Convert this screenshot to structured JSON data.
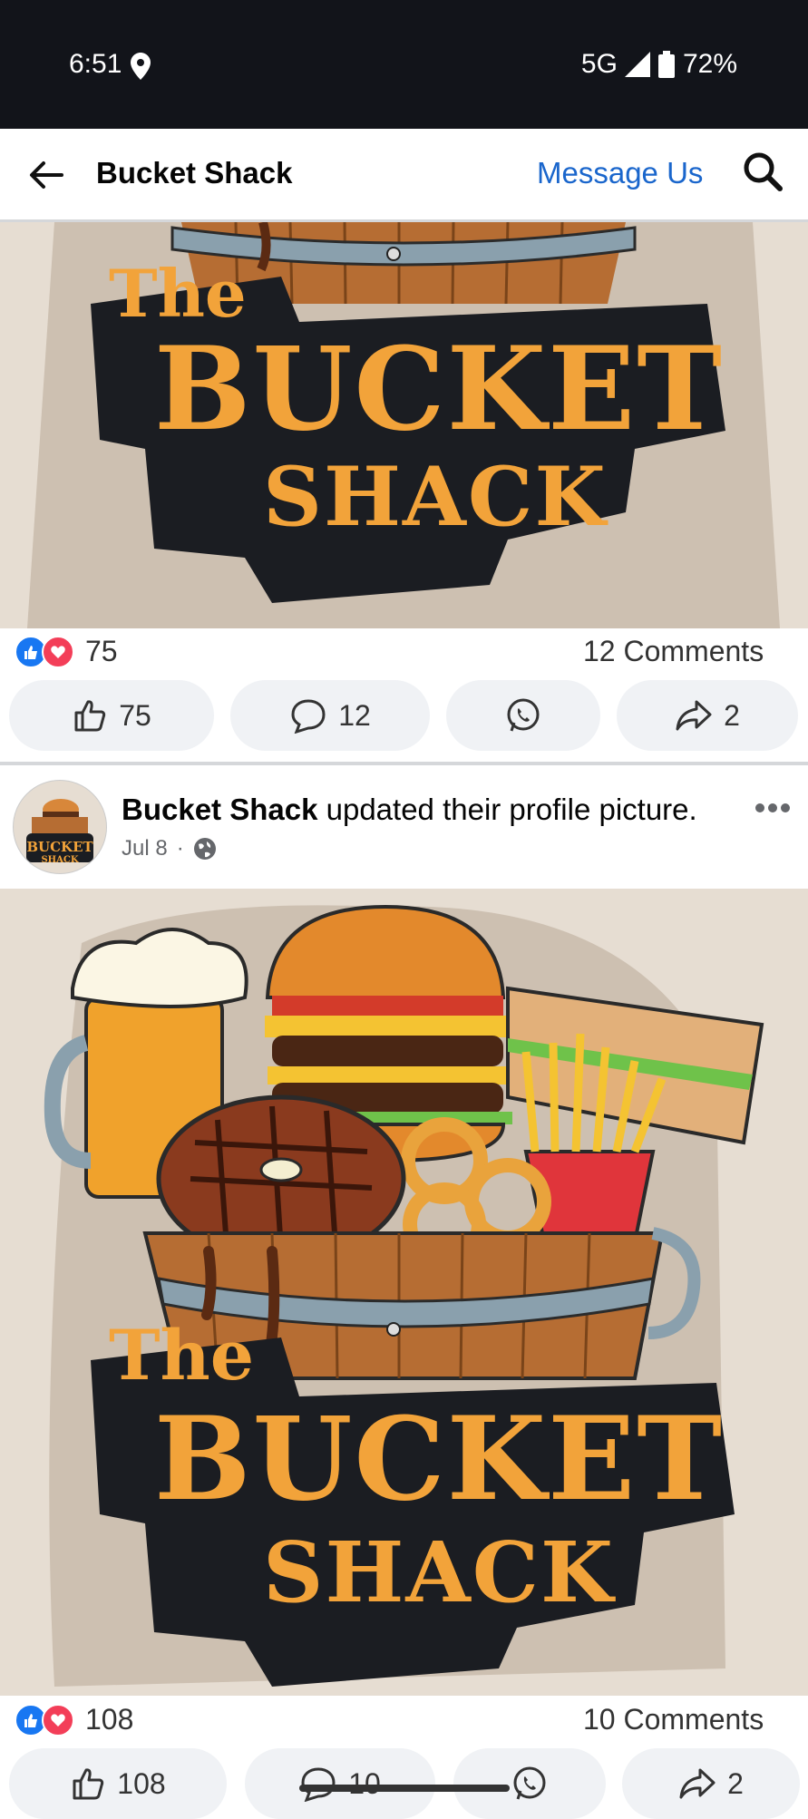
{
  "status_bar": {
    "time": "6:51",
    "network": "5G",
    "battery": "72%"
  },
  "header": {
    "title": "Bucket Shack",
    "message_link": "Message Us"
  },
  "logo": {
    "line1": "The",
    "line2": "BUCKET",
    "line3": "SHACK"
  },
  "post1": {
    "reaction_count": "75",
    "comments_text": "12 Comments",
    "like_count": "75",
    "comment_count": "12",
    "share_count": "2"
  },
  "post2": {
    "author": "Bucket Shack",
    "action_text": "updated their profile picture.",
    "date": "Jul 8",
    "separator": "·",
    "reaction_count": "108",
    "comments_text": "10 Comments",
    "like_count": "108",
    "comment_count": "10",
    "share_count": "2"
  },
  "colors": {
    "accent": "#1a66cc",
    "like_blue": "#1877f2",
    "love_red": "#f33e58",
    "logo_orange": "#f2a33a"
  }
}
